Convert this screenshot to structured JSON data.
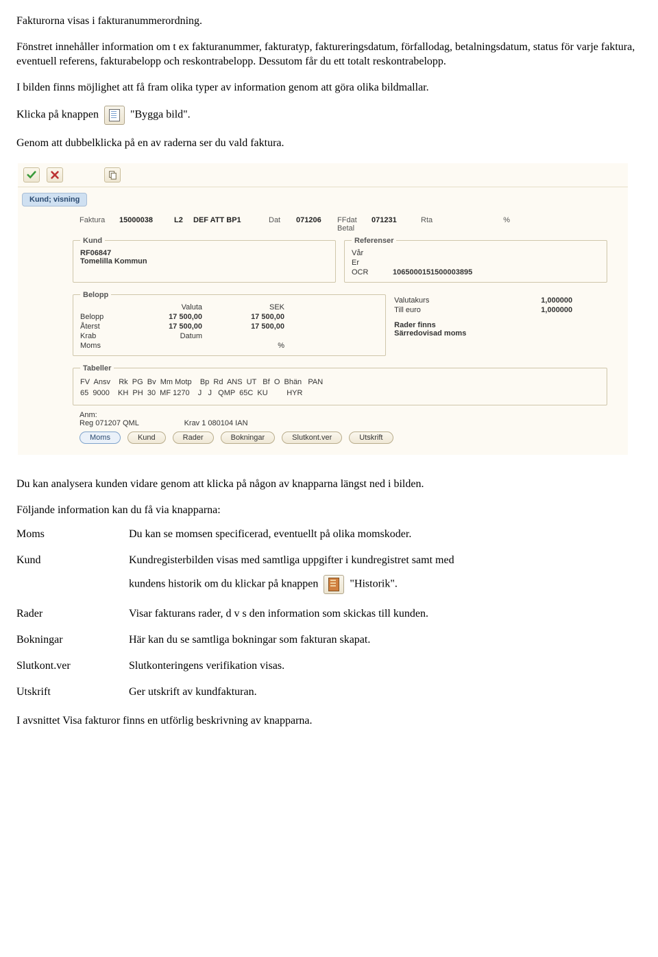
{
  "intro": {
    "p1": "Fakturorna visas i fakturanummerordning.",
    "p2": "Fönstret innehåller information om t ex fakturanummer, fakturatyp, faktureringsdatum, förfallodag, betalningsdatum, status för varje faktura, eventuell referens, fakturabelopp och reskontrabelopp. Dessutom får du ett totalt reskontrabelopp.",
    "p3": "I bilden finns möjlighet att få fram olika typer av information genom att göra olika bildmallar.",
    "p4a": "Klicka på knappen",
    "p4b": "\"Bygga bild\".",
    "p5": "Genom att dubbelklicka på en av raderna ser du vald faktura."
  },
  "app": {
    "title": "Kund; visning",
    "header": {
      "faktura_label": "Faktura",
      "faktura_value": "15000038",
      "l2": "L2",
      "defatt": "DEF ATT BP1",
      "dat_label": "Dat",
      "dat_value": "071206",
      "ffdat_label": "FFdat",
      "ffdat_value": "071231",
      "betal_label": "Betal",
      "rta_label": "Rta",
      "pct_label": "%"
    },
    "kund": {
      "legend": "Kund",
      "kod": "RF06847",
      "namn": "Tomelilla Kommun"
    },
    "refs": {
      "legend": "Referenser",
      "var_label": "Vår",
      "er_label": "Er",
      "ocr_label": "OCR",
      "ocr_value": "1065000151500003895"
    },
    "belopp": {
      "legend": "Belopp",
      "valuta_label": "Valuta",
      "sek_label": "SEK",
      "belopp_label": "Belopp",
      "belopp_v1": "17 500,00",
      "belopp_v2": "17 500,00",
      "aterst_label": "Återst",
      "aterst_v1": "17 500,00",
      "aterst_v2": "17 500,00",
      "krab_label": "Krab",
      "datum_label": "Datum",
      "moms_label": "Moms",
      "pct_label": "%"
    },
    "belopp_right": {
      "valutakurs_label": "Valutakurs",
      "valutakurs_value": "1,000000",
      "tilleuro_label": "Till euro",
      "tilleuro_value": "1,000000",
      "rader_finns": "Rader finns",
      "sarredov": "Särredovisad moms"
    },
    "tabeller": {
      "legend": "Tabeller",
      "head": "FV  Ansv    Rk  PG  Bv  Mm Motp    Bp  Rd  ANS  UT   Bf  O  Bhän   PAN",
      "row": "65  9000    KH  PH  30  MF 1270    J   J   QMP  65C  KU         HYR"
    },
    "anm_label": "Anm:",
    "anm_reg": "Reg 071207 QML",
    "anm_krav": "Krav 1 080104 IAN",
    "buttons": {
      "moms": "Moms",
      "kund": "Kund",
      "rader": "Rader",
      "bokningar": "Bokningar",
      "slutkont": "Slutkont.ver",
      "utskrift": "Utskrift"
    }
  },
  "post": {
    "p1": "Du kan analysera kunden vidare genom att klicka på någon av knapparna längst ned i bilden.",
    "p2": "Följande information kan du få via knapparna:"
  },
  "defs": {
    "moms_t": "Moms",
    "moms_d": "Du kan se momsen specificerad, eventuellt på olika momskoder.",
    "kund_t": "Kund",
    "kund_d1": "Kundregisterbilden visas med samtliga uppgifter i kundregistret samt med",
    "kund_d2a": "kundens historik om du klickar på knappen",
    "kund_d2b": "\"Historik\".",
    "rader_t": "Rader",
    "rader_d": "Visar fakturans rader, d v s den information som skickas till kunden.",
    "bok_t": "Bokningar",
    "bok_d": "Här kan du se samtliga bokningar som fakturan skapat.",
    "slut_t": "Slutkont.ver",
    "slut_d": "Slutkonteringens verifikation visas.",
    "ut_t": "Utskrift",
    "ut_d": "Ger utskrift av kundfakturan."
  },
  "outro": "I avsnittet Visa fakturor finns en utförlig beskrivning av knapparna."
}
